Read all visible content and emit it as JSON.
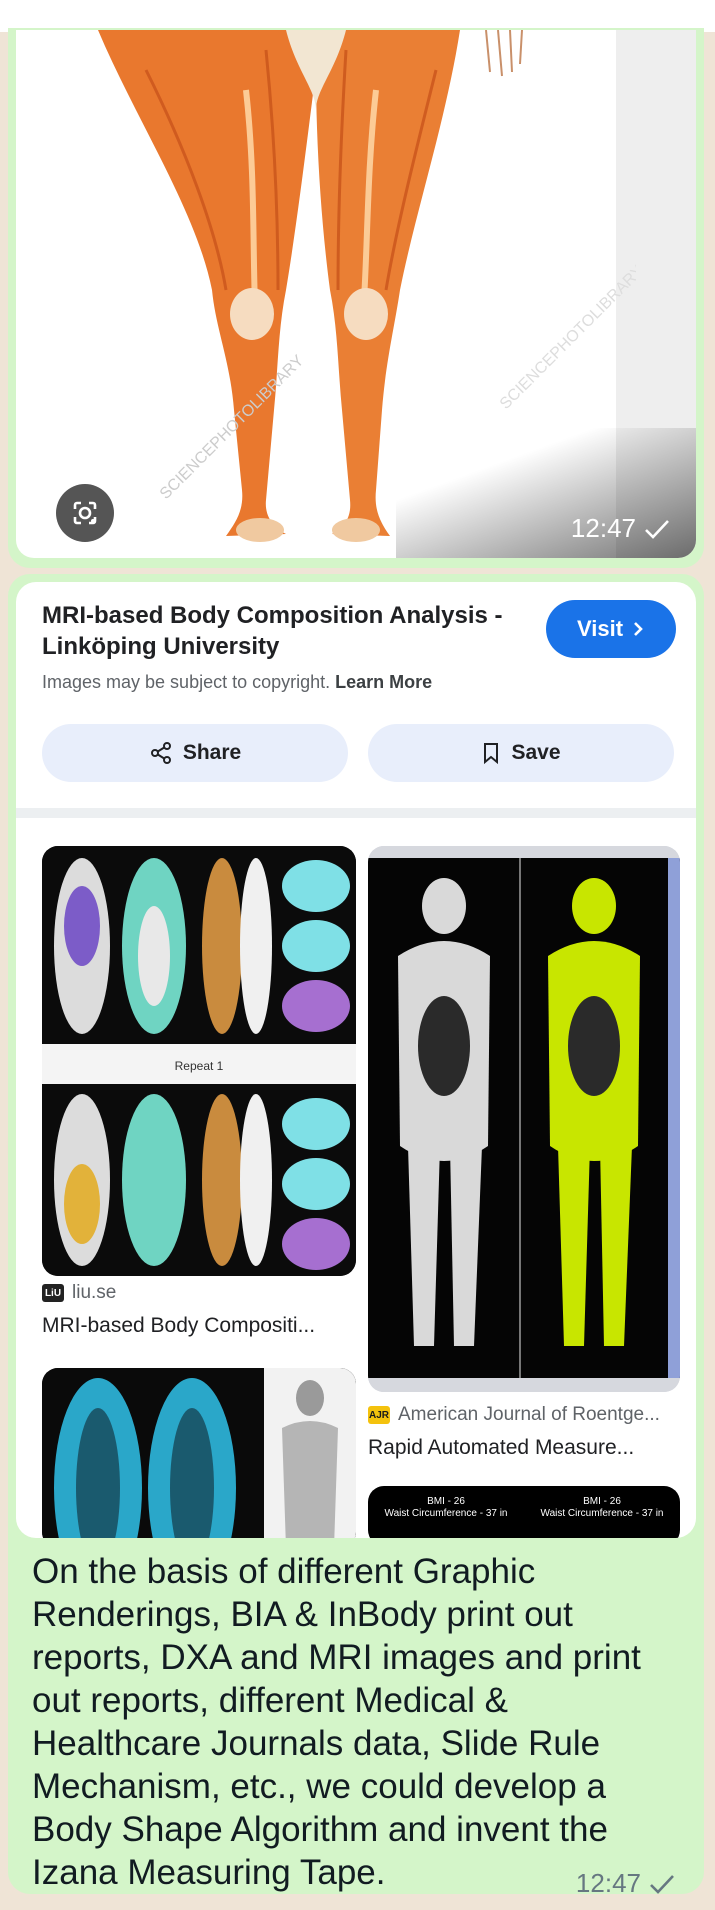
{
  "image_message": {
    "time": "12:47",
    "watermark": "SCIENCEPHOTOLIBRARY"
  },
  "lens_card": {
    "title": "MRI-based Body Composition Analysis - Linköping University",
    "visit_label": "Visit",
    "copyright_text": "Images may be subject to copyright.",
    "learn_more": "Learn More",
    "share_label": "Share",
    "save_label": "Save",
    "results": [
      {
        "source_icon": "LiU",
        "source": "liu.se",
        "caption": "MRI-based Body Compositi...",
        "inner_label": "Repeat 1"
      },
      {
        "source_icon": "AJR",
        "source": "American Journal of Roentge...",
        "caption": "Rapid Automated Measure..."
      }
    ],
    "bmi_labels": [
      {
        "line1": "BMI - 26",
        "line2": "Waist Circumference - 37 in"
      },
      {
        "line1": "BMI - 26",
        "line2": "Waist Circumference - 37 in"
      }
    ]
  },
  "text_message": {
    "text": "On the basis of different Graphic Renderings, BIA & InBody print out reports, DXA and MRI images and print out reports, different Medical & Healthcare Journals data, Slide Rule Mechanism, etc., we could develop a Body Shape Algorithm and invent the Izana Measuring Tape.",
    "time": "12:47"
  },
  "colors": {
    "bubble": "#d4f5c9",
    "visit_button": "#1a73e8",
    "pill": "#e8eefb",
    "mri_highlight": "#c8e600"
  },
  "icons": [
    "google-lens-icon",
    "check-icon",
    "share-icon",
    "bookmark-icon",
    "chevron-right-icon"
  ]
}
